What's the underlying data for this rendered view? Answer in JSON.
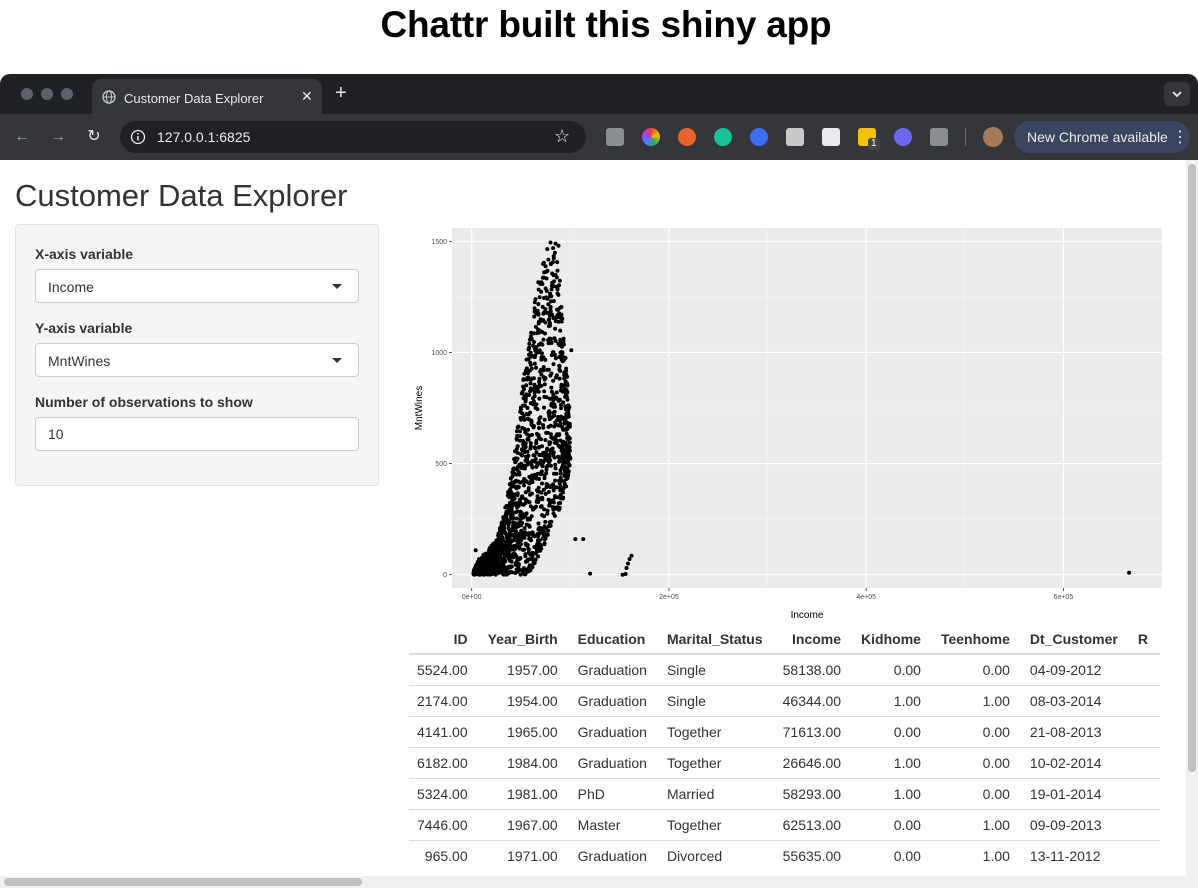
{
  "banner": {
    "title": "Chattr built this shiny app"
  },
  "browser": {
    "tab_title": "Customer Data Explorer",
    "url": "127.0.0.1:6825",
    "update_label": "New Chrome available",
    "extension_badge": "1"
  },
  "app": {
    "title": "Customer Data Explorer",
    "x_label": "X-axis variable",
    "x_value": "Income",
    "y_label": "Y-axis variable",
    "y_value": "MntWines",
    "n_label": "Number of observations to show",
    "n_value": "10"
  },
  "chart_data": {
    "type": "scatter",
    "xlabel": "Income",
    "ylabel": "MntWines",
    "xlim": [
      -20000,
      700000
    ],
    "ylim": [
      -60,
      1560
    ],
    "x_ticks": [
      0,
      200000,
      400000,
      600000
    ],
    "x_tick_labels": [
      "0e+00",
      "2e+05",
      "4e+05",
      "6e+05"
    ],
    "y_ticks": [
      0,
      500,
      1000,
      1500
    ],
    "y_tick_labels": [
      "0",
      "500",
      "1000",
      "1500"
    ],
    "grid": true,
    "panel_color": "#ebebeb",
    "point_color": "#000000",
    "cluster_profile": [
      [
        2000,
        0,
        30
      ],
      [
        5000,
        0,
        50
      ],
      [
        10000,
        0,
        80
      ],
      [
        15000,
        0,
        100
      ],
      [
        20000,
        0,
        130
      ],
      [
        25000,
        0,
        160
      ],
      [
        30000,
        0,
        230
      ],
      [
        35000,
        0,
        330
      ],
      [
        40000,
        0,
        460
      ],
      [
        45000,
        0,
        620
      ],
      [
        50000,
        0,
        800
      ],
      [
        55000,
        0,
        960
      ],
      [
        60000,
        20,
        1120
      ],
      [
        65000,
        60,
        1260
      ],
      [
        70000,
        100,
        1370
      ],
      [
        75000,
        150,
        1460
      ],
      [
        80000,
        200,
        1500
      ],
      [
        85000,
        260,
        1470
      ],
      [
        90000,
        300,
        1300
      ],
      [
        95000,
        380,
        1000
      ],
      [
        100000,
        500,
        700
      ]
    ],
    "cluster_count": 1700,
    "outliers": [
      [
        1730,
        5
      ],
      [
        4000,
        110
      ],
      [
        4900,
        40
      ],
      [
        7500,
        70
      ],
      [
        12000,
        90
      ],
      [
        85000,
        1490
      ],
      [
        88000,
        1480
      ],
      [
        92000,
        1000
      ],
      [
        101000,
        1010
      ],
      [
        97000,
        820
      ],
      [
        105000,
        160
      ],
      [
        113000,
        160
      ],
      [
        120000,
        5
      ],
      [
        153000,
        0
      ],
      [
        156000,
        3
      ],
      [
        157000,
        30
      ],
      [
        158500,
        50
      ],
      [
        160000,
        70
      ],
      [
        162000,
        85
      ],
      [
        666666,
        9
      ]
    ]
  },
  "table": {
    "columns": [
      "ID",
      "Year_Birth",
      "Education",
      "Marital_Status",
      "Income",
      "Kidhome",
      "Teenhome",
      "Dt_Customer",
      "R"
    ],
    "align": [
      "num",
      "num",
      "txt",
      "txt",
      "num",
      "num",
      "num",
      "txt",
      "txt"
    ],
    "rows": [
      [
        "5524.00",
        "1957.00",
        "Graduation",
        "Single",
        "58138.00",
        "0.00",
        "0.00",
        "04-09-2012",
        ""
      ],
      [
        "2174.00",
        "1954.00",
        "Graduation",
        "Single",
        "46344.00",
        "1.00",
        "1.00",
        "08-03-2014",
        ""
      ],
      [
        "4141.00",
        "1965.00",
        "Graduation",
        "Together",
        "71613.00",
        "0.00",
        "0.00",
        "21-08-2013",
        ""
      ],
      [
        "6182.00",
        "1984.00",
        "Graduation",
        "Together",
        "26646.00",
        "1.00",
        "0.00",
        "10-02-2014",
        ""
      ],
      [
        "5324.00",
        "1981.00",
        "PhD",
        "Married",
        "58293.00",
        "1.00",
        "0.00",
        "19-01-2014",
        ""
      ],
      [
        "7446.00",
        "1967.00",
        "Master",
        "Together",
        "62513.00",
        "0.00",
        "1.00",
        "09-09-2013",
        ""
      ],
      [
        "965.00",
        "1971.00",
        "Graduation",
        "Divorced",
        "55635.00",
        "0.00",
        "1.00",
        "13-11-2012",
        ""
      ]
    ]
  }
}
